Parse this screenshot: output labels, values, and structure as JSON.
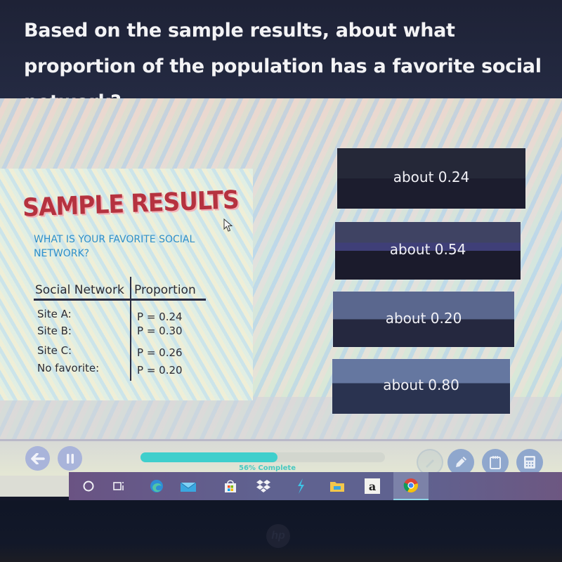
{
  "question": {
    "text": "Based on the sample results, about what proportion of the population has a favorite social network?"
  },
  "sample_card": {
    "title": "SAMPLE RESULTS",
    "survey_question": "WHAT IS YOUR FAVORITE SOCIAL NETWORK?",
    "table": {
      "headers": [
        "Social Network",
        "Proportion"
      ],
      "rows": [
        {
          "site": "Site A:",
          "proportion": "P = 0.24"
        },
        {
          "site": "Site B:",
          "proportion": "P = 0.30"
        },
        {
          "site": "Site C:",
          "proportion": "P = 0.26"
        },
        {
          "site": "No favorite:",
          "proportion": "P = 0.20"
        }
      ]
    }
  },
  "answers": [
    {
      "label": "about 0.24"
    },
    {
      "label": "about 0.54"
    },
    {
      "label": "about 0.20"
    },
    {
      "label": "about 0.80"
    }
  ],
  "controls": {
    "back_icon": "arrow-left-icon",
    "pause_icon": "pause-icon",
    "progress_percent": 56,
    "progress_label": "56% Complete",
    "tools": [
      "highlighter-icon",
      "pencil-icon",
      "notepad-icon",
      "calculator-icon"
    ]
  },
  "taskbar": {
    "items": [
      {
        "name": "search",
        "icon": "cortana-circle-icon"
      },
      {
        "name": "task-view",
        "icon": "task-view-icon"
      },
      {
        "name": "edge",
        "icon": "edge-icon"
      },
      {
        "name": "mail",
        "icon": "mail-icon"
      },
      {
        "name": "store",
        "icon": "store-icon"
      },
      {
        "name": "dropbox",
        "icon": "dropbox-icon"
      },
      {
        "name": "app-bolt",
        "icon": "bolt-icon"
      },
      {
        "name": "file-explorer",
        "icon": "folder-icon"
      },
      {
        "name": "amazon",
        "icon": "amazon-icon",
        "glyph": "a"
      },
      {
        "name": "chrome",
        "icon": "chrome-icon",
        "active": true
      }
    ]
  },
  "colors": {
    "accent_progress": "#3fcfcc",
    "title_red": "#b5323f",
    "question_blue": "#2e8fca",
    "answer_dark": "#1c1d2e",
    "tool_blue": "#8fa7cd"
  }
}
